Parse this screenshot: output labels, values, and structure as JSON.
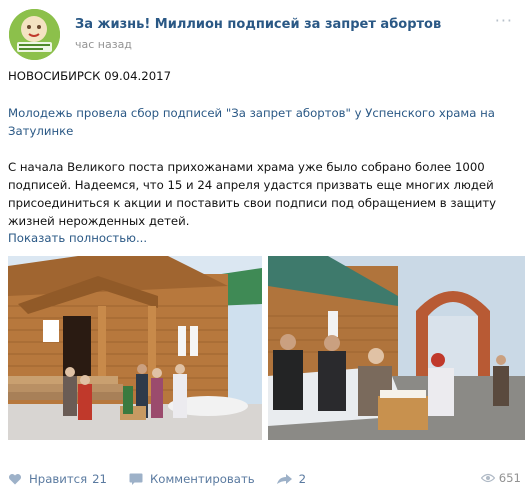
{
  "post": {
    "author": "За жизнь! Миллион подписей за запрет абортов",
    "time": "час назад",
    "more": "···",
    "dateline": "НОВОСИБИРСК 09.04.2017",
    "subtitle_lines": [
      "Молодежь провела сбор подписей \"За запрет абортов\" у Успенского храма на",
      "Затулинке"
    ],
    "body_lines": [
      "С начала Великого поста прихожанами храма уже было собрано более 1000",
      "подписей. Надеемся, что 15 и 24 апреля удастся призвать еще многих людей",
      "присоединиться к акции и поставить свои подписи под обращением в защиту",
      "жизней нерожденных детей."
    ],
    "show_more": "Показать полностью..."
  },
  "actions": {
    "like_label": "Нравится",
    "like_count": "21",
    "comment_label": "Комментировать",
    "share_count": "2",
    "views_count": "651"
  },
  "colors": {
    "link": "#2a5885",
    "muted": "#939393",
    "action": "#5a7aa0"
  },
  "icons": [
    "heart-icon",
    "comment-icon",
    "share-icon",
    "eye-icon",
    "more-icon"
  ]
}
